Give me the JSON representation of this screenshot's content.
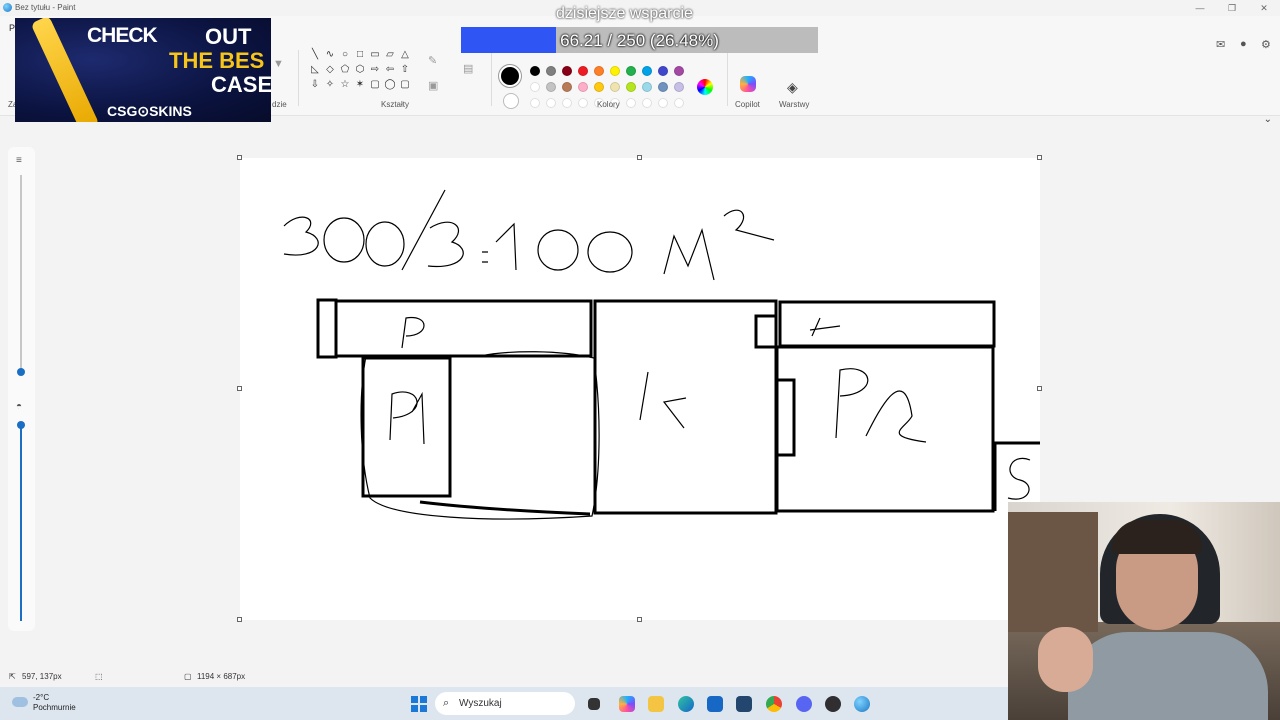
{
  "window": {
    "title": "Bez tytułu - Paint",
    "buttons": [
      "—",
      "❐",
      "✕"
    ]
  },
  "ribbon": {
    "file_tab": "P",
    "groups": {
      "left_partial": "Za",
      "tools_partial": "dzie",
      "shapes": "Kształty",
      "colors": "Kolory",
      "copilot": "Copilot",
      "layers": "Warstwy"
    },
    "shapes_glyphs": [
      "╲",
      "∿",
      "○",
      "□",
      "▭",
      "▱",
      "△",
      "◺",
      "◇",
      "⬠",
      "⬡",
      "⇨",
      "⇦",
      "⇧",
      "⇩",
      "✧",
      "☆",
      "✶",
      "▢",
      "◯",
      "▢"
    ],
    "palette": [
      "#000000",
      "#7f7f7f",
      "#880015",
      "#ed1c24",
      "#ff7f27",
      "#fff200",
      "#22b14c",
      "#00a2e8",
      "#3f48cc",
      "#a349a4",
      "#ffffff",
      "#c3c3c3",
      "#b97a57",
      "#ffaec9",
      "#ffc90e",
      "#efe4b0",
      "#b5e61d",
      "#99d9ea",
      "#7092be",
      "#c8bfe7",
      "#ffffff",
      "#ffffff",
      "#ffffff",
      "#ffffff",
      "#ffffff",
      "#ffffff",
      "#ffffff",
      "#ffffff",
      "#ffffff",
      "#ffffff"
    ],
    "primary_color": "#000000",
    "secondary_color": "#ffffff"
  },
  "overlays": {
    "donation_title": "dzisiejsze wsparcie",
    "donation_text": "66.21 / 250 (26.48%)",
    "donation_progress": 0.2648,
    "ad": {
      "line1": "CHECK",
      "line1b": "OUT",
      "line2": "THE BES",
      "line3": "CASE",
      "brand": "CSG⊙SKINS"
    }
  },
  "canvas": {
    "drawing_text": {
      "equation": "300/3=100m²",
      "room_p": "P",
      "room_k_top": "K",
      "room_p1": "P1",
      "room_k": "K",
      "room_p2": "P2",
      "room_s": "S"
    }
  },
  "status": {
    "cursor_pos": "597, 137px",
    "canvas_size": "1194 × 687px"
  },
  "taskbar": {
    "weather_temp": "-2°C",
    "weather_desc": "Pochmurnie",
    "search_placeholder": "Wyszukaj",
    "icons": [
      "task-view-icon",
      "copilot-icon",
      "explorer-icon",
      "edge-icon",
      "outlook-icon",
      "store-icon",
      "chrome-icon",
      "discord-icon",
      "obs-icon",
      "paint-icon"
    ]
  }
}
